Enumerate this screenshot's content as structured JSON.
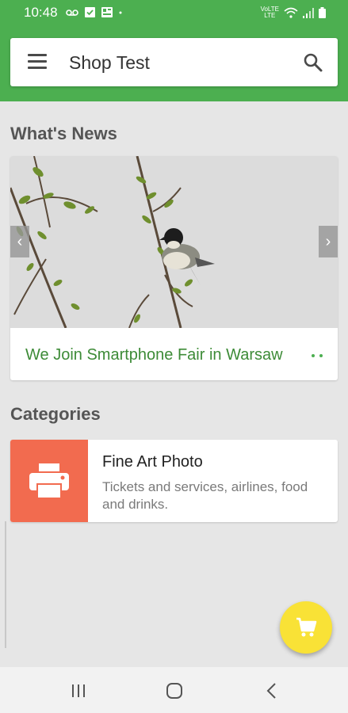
{
  "status_bar": {
    "time": "10:48",
    "icons_left": [
      "voicemail-icon",
      "check-box-icon",
      "image-icon",
      "dot-icon"
    ],
    "icons_right": [
      "volte-icon",
      "wifi-icon",
      "signal-icon",
      "battery-icon"
    ],
    "lte_label": "LTE"
  },
  "app_bar": {
    "title": "Shop Test",
    "menu_icon": "hamburger-menu-icon",
    "search_icon": "search-icon"
  },
  "whats_news": {
    "heading": "What's News",
    "slides": [
      {
        "caption": "We Join Smartphone Fair  in Warsaw"
      }
    ],
    "prev_icon": "chevron-left-icon",
    "next_icon": "chevron-right-icon"
  },
  "categories": {
    "heading": "Categories",
    "items": [
      {
        "name": "Fine Art Photo",
        "description": "Tickets and services, airlines, food and drinks.",
        "icon": "printer-icon"
      }
    ]
  },
  "fab": {
    "icon": "shopping-cart-icon"
  },
  "nav_bar": {
    "buttons": [
      "recent-apps-icon",
      "home-icon",
      "back-icon"
    ]
  },
  "colors": {
    "primary": "#4caf50",
    "accent": "#f9e236",
    "category_thumb": "#f26b4f",
    "caption_text": "#3d8b37"
  }
}
